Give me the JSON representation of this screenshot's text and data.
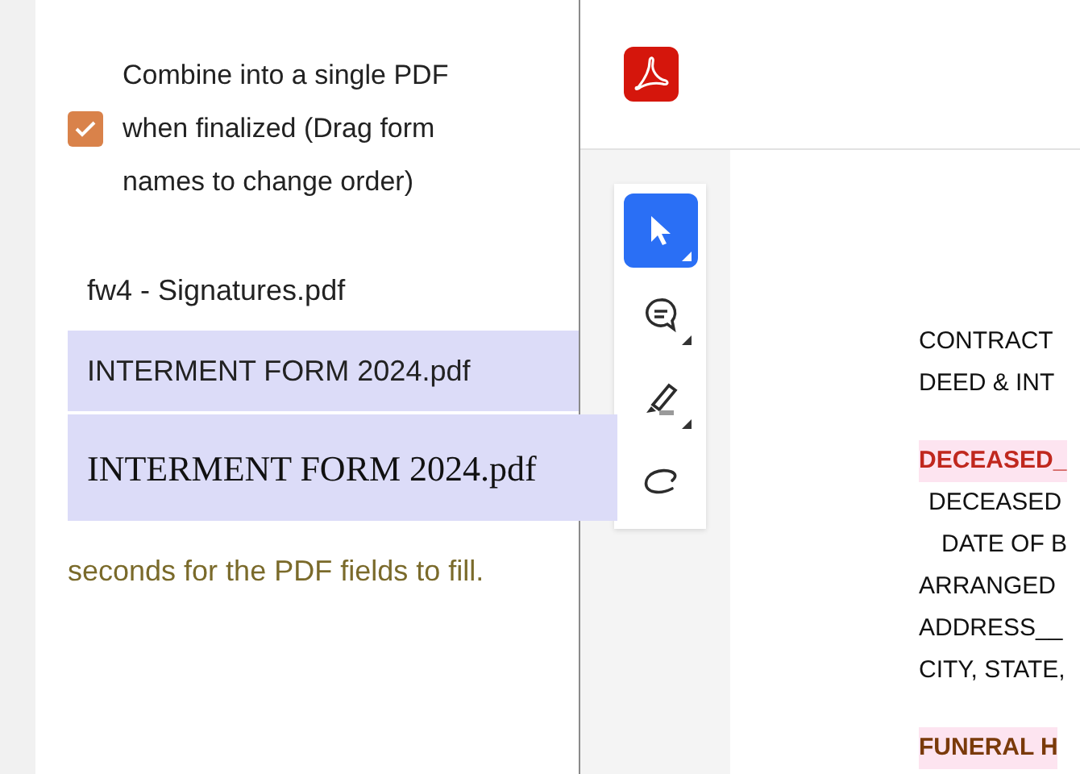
{
  "combine_option": {
    "label": "Combine into a single PDF when finalized (Drag form names to change order)",
    "checked": true
  },
  "files": [
    {
      "name": "fw4 - Signatures.pdf",
      "selected": false
    },
    {
      "name": "INTERMENT FORM 2024.pdf",
      "selected": true
    }
  ],
  "drag_ghost": {
    "label": "INTERMENT FORM 2024.pdf"
  },
  "note": "seconds for the PDF fields to fill.",
  "tools": [
    {
      "kind": "select",
      "selected": true,
      "menu": true
    },
    {
      "kind": "comment",
      "selected": false,
      "menu": true
    },
    {
      "kind": "highlight",
      "selected": false,
      "menu": true
    },
    {
      "kind": "draw",
      "selected": false,
      "menu": false
    }
  ],
  "document_lines": [
    {
      "text": "CONTRACT",
      "kind": "plain"
    },
    {
      "text": "DEED & INT",
      "kind": "plain"
    },
    {
      "text": "DECEASED_",
      "kind": "heading"
    },
    {
      "text": "DECEASED",
      "kind": "indent"
    },
    {
      "text": "DATE OF B",
      "kind": "indent2"
    },
    {
      "text": "ARRANGED",
      "kind": "plain"
    },
    {
      "text": "ADDRESS__",
      "kind": "plain"
    },
    {
      "text": "CITY, STATE,",
      "kind": "plain"
    },
    {
      "text": "FUNERAL H",
      "kind": "section"
    }
  ]
}
